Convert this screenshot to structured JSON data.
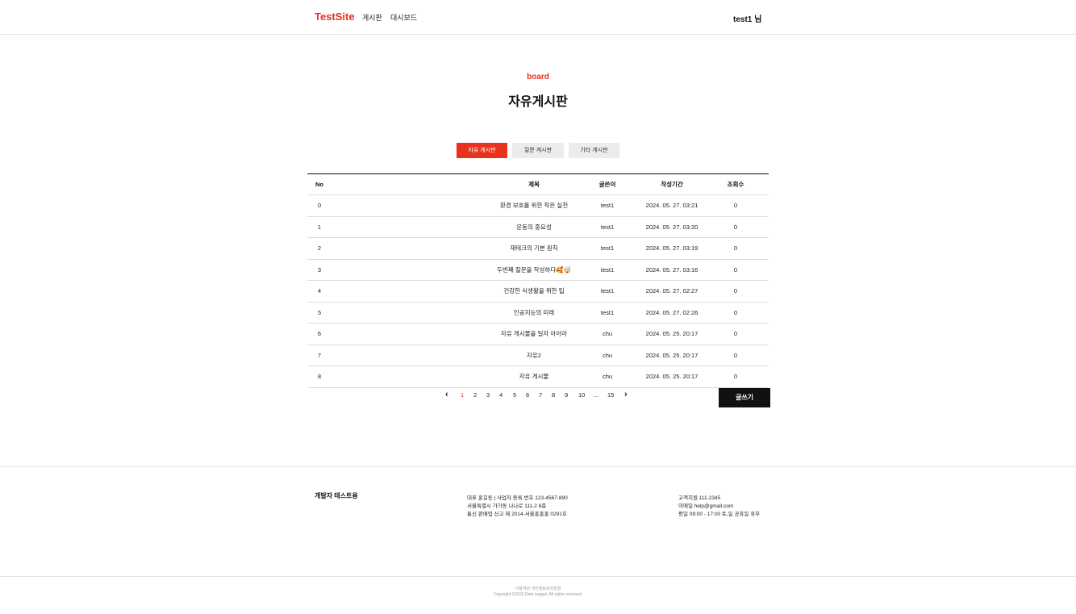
{
  "header": {
    "logo": "TestSite",
    "nav": [
      "게시판",
      "대시보드"
    ],
    "user": "test1 님"
  },
  "hero": {
    "eyebrow": "board",
    "title": "자유게시판"
  },
  "tabs": [
    {
      "label": "자유 게시판",
      "active": true
    },
    {
      "label": "질문 게시판",
      "active": false
    },
    {
      "label": "기타 게시판",
      "active": false
    }
  ],
  "table": {
    "headers": {
      "no": "No",
      "title": "제목",
      "author": "글쓴이",
      "date": "작성기간",
      "views": "조회수"
    },
    "rows": [
      {
        "no": "0",
        "title": "환경 보호를 위한 작은 실천",
        "author": "test1",
        "date": "2024. 05. 27. 03:21",
        "views": "0"
      },
      {
        "no": "1",
        "title": "운동의 중요성",
        "author": "test1",
        "date": "2024. 05. 27. 03:20",
        "views": "0"
      },
      {
        "no": "2",
        "title": "재테크의 기본 원칙",
        "author": "test1",
        "date": "2024. 05. 27. 03:19",
        "views": "0"
      },
      {
        "no": "3",
        "title": "두번째 질문을 작성하다🥰🤯",
        "author": "test1",
        "date": "2024. 05. 27. 03:16",
        "views": "0"
      },
      {
        "no": "4",
        "title": "건강한 식생활을 위한 팁",
        "author": "test1",
        "date": "2024. 05. 27. 02:27",
        "views": "0"
      },
      {
        "no": "5",
        "title": "인공지능의 미래",
        "author": "test1",
        "date": "2024. 05. 27. 02:26",
        "views": "0"
      },
      {
        "no": "6",
        "title": "자유 게시물을 딜자 아이아",
        "author": "chu",
        "date": "2024. 05. 25. 20:17",
        "views": "0"
      },
      {
        "no": "7",
        "title": "자유2",
        "author": "chu",
        "date": "2024. 05. 25. 20:17",
        "views": "0"
      },
      {
        "no": "8",
        "title": "자유 게시물",
        "author": "chu",
        "date": "2024. 05. 25. 20:17",
        "views": "0"
      }
    ]
  },
  "pagination": {
    "prev": "‹",
    "next": "›",
    "pages": [
      "1",
      "2",
      "3",
      "4",
      "5",
      "6",
      "7",
      "8",
      "9",
      "10",
      "...",
      "15"
    ],
    "current": "1"
  },
  "write_button": "글쓰기",
  "footer": {
    "brand": "개발자 테스트용",
    "company_lines": [
      "대표 홍길동  |  사업자 등록 번호 123-4567-890",
      "서울특별시 가가동 나나로 111-2 8층",
      "통신 판매업 신고 제 2014-서울홍홍홍 0291호"
    ],
    "contact_lines": [
      "고객지원 111-2345",
      "이메일 help@gmail.com",
      "평일 09:00 - 17:00 토,일 공휴일 휴무"
    ],
    "copyright_lines": [
      "이용약관 개인정보처리방침",
      "Copyright ©2023 Data nugget. All rights reserved."
    ]
  },
  "colors": {
    "accent": "#e8321e",
    "dark": "#111111",
    "tab_inactive": "#ececec"
  }
}
